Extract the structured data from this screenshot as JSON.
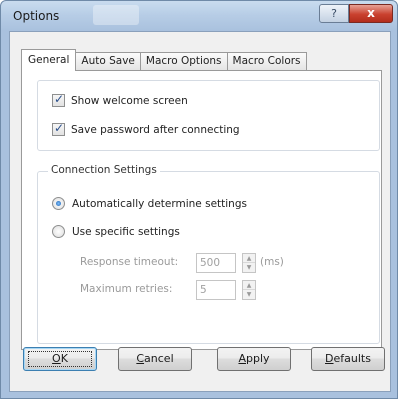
{
  "window": {
    "title": "Options",
    "help_glyph": "?",
    "close_glyph": "x"
  },
  "tabs": [
    {
      "label": "General",
      "active": true
    },
    {
      "label": "Auto Save",
      "active": false
    },
    {
      "label": "Macro Options",
      "active": false
    },
    {
      "label": "Macro Colors",
      "active": false
    }
  ],
  "general": {
    "show_welcome": {
      "label": "Show welcome screen",
      "checked": true
    },
    "save_password": {
      "label": "Save password after connecting",
      "checked": true
    }
  },
  "connection": {
    "caption": "Connection Settings",
    "auto": {
      "label": "Automatically determine settings",
      "selected": true
    },
    "specific": {
      "label": "Use specific settings",
      "selected": false
    },
    "response_timeout": {
      "label": "Response timeout:",
      "value": "500",
      "unit": "(ms)"
    },
    "max_retries": {
      "label": "Maximum retries:",
      "value": "5"
    }
  },
  "buttons": {
    "ok": {
      "mnemonic": "O",
      "rest": "K"
    },
    "cancel": {
      "mnemonic": "C",
      "rest": "ancel"
    },
    "apply": {
      "mnemonic": "A",
      "rest": "pply"
    },
    "defaults": {
      "mnemonic": "D",
      "rest": "efaults"
    }
  },
  "icons": {
    "checkbox_tick": "✓",
    "spin_up": "▲",
    "spin_down": "▼"
  },
  "colors": {
    "titlebar": "#b7cde6",
    "close_button": "#c9412f",
    "radio_selected": "#1c5fae"
  }
}
